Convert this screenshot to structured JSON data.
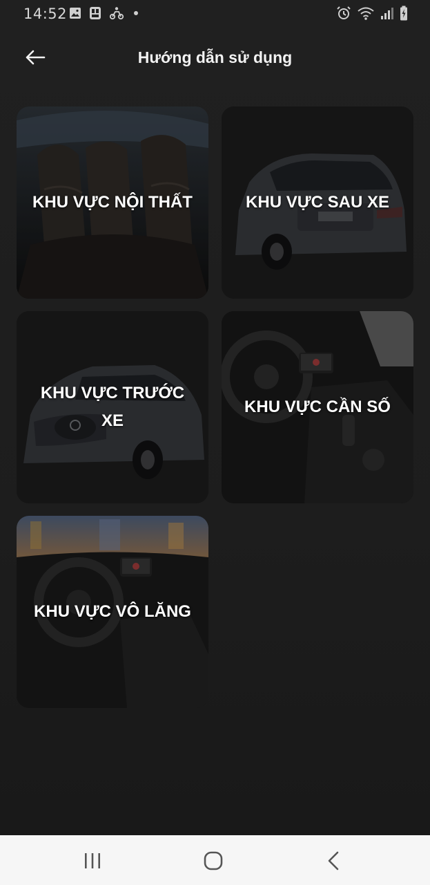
{
  "status_bar": {
    "time": "14:52",
    "left_icons": [
      "gallery-icon",
      "sim-icon",
      "delivery-icon"
    ],
    "right_icons": [
      "alarm-icon",
      "wifi-icon",
      "signal-icon",
      "battery-charging-icon"
    ]
  },
  "header": {
    "title": "Hướng dẫn sử dụng",
    "back_icon": "arrow-left-icon"
  },
  "cards": [
    {
      "id": "interior",
      "label": "KHU VỰC NỘI THẤT",
      "image": "car-interior-seats"
    },
    {
      "id": "rear",
      "label": "KHU VỰC SAU XE",
      "image": "car-rear-view"
    },
    {
      "id": "front",
      "label": "KHU VỰC TRƯỚC XE",
      "image": "car-front-view"
    },
    {
      "id": "gear",
      "label": "KHU VỰC CẦN SỐ",
      "image": "gear-shift-console"
    },
    {
      "id": "steering",
      "label": "KHU VỰC VÔ LĂNG",
      "image": "steering-wheel-dashboard"
    }
  ],
  "nav_bar": {
    "buttons": [
      "recent-apps-icon",
      "home-icon",
      "back-icon"
    ]
  },
  "colors": {
    "background": "#1f1f1f",
    "card_background": "#141414",
    "nav_bar": "#f6f6f6",
    "text": "#ffffff"
  }
}
